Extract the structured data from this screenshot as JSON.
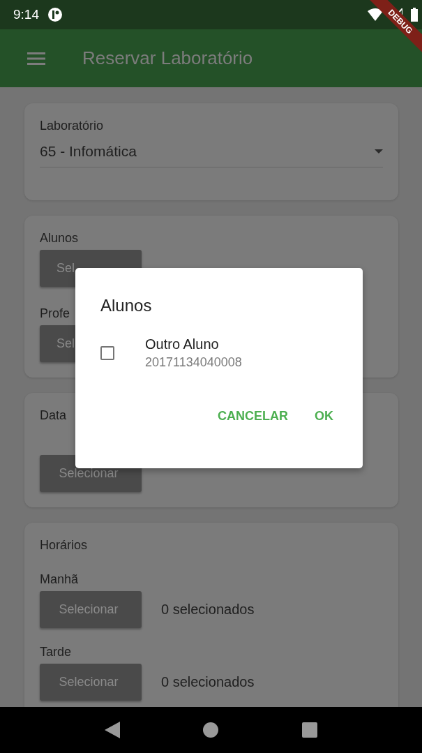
{
  "status_bar": {
    "time": "9:14"
  },
  "app_bar": {
    "title": "Reservar Laboratório"
  },
  "debug_banner": "DEBUG",
  "laboratorio": {
    "label": "Laboratório",
    "value": "65 - Infomática"
  },
  "participants": [
    {
      "label": "Alunos",
      "button": "Sel"
    },
    {
      "label": "Profe",
      "button": "Sel"
    }
  ],
  "data": {
    "label": "Data",
    "button": "Selecionar"
  },
  "horarios": {
    "title": "Horários",
    "periods": [
      {
        "label": "Manhã",
        "button": "Selecionar",
        "count": "0 selecionados"
      },
      {
        "label": "Tarde",
        "button": "Selecionar",
        "count": "0 selecionados"
      }
    ]
  },
  "dialog": {
    "title": "Alunos",
    "items": [
      {
        "name": "Outro Aluno",
        "id": "20171134040008",
        "checked": false
      }
    ],
    "actions": [
      "CANCELAR",
      "OK"
    ]
  }
}
